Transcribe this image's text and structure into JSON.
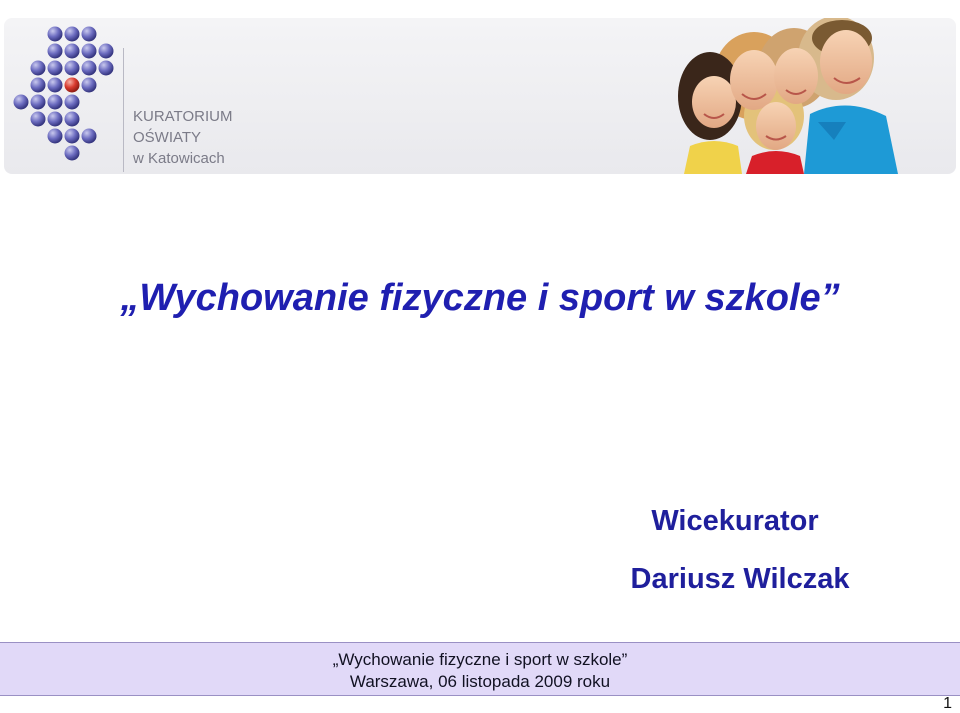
{
  "header": {
    "logo": {
      "line1": "KURATORIUM",
      "line2": "OŚWIATY",
      "line3": "w Katowicach",
      "dot_color": "#5a5ab0",
      "accent_dot_color": "#d83a2e"
    },
    "photo": "children-group-photo"
  },
  "slide": {
    "title": "„Wychowanie fizyczne i sport w szkole”",
    "author_role": "Wicekurator",
    "author_name": "Dariusz Wilczak"
  },
  "footer": {
    "line1": "„Wychowanie fizyczne i sport w szkole”",
    "line2": "Warszawa, 06 listopada 2009 roku",
    "background": "#e1d9f8"
  },
  "page_number": "1",
  "colors": {
    "title": "#1f1fb0",
    "author": "#1f1f9c"
  }
}
